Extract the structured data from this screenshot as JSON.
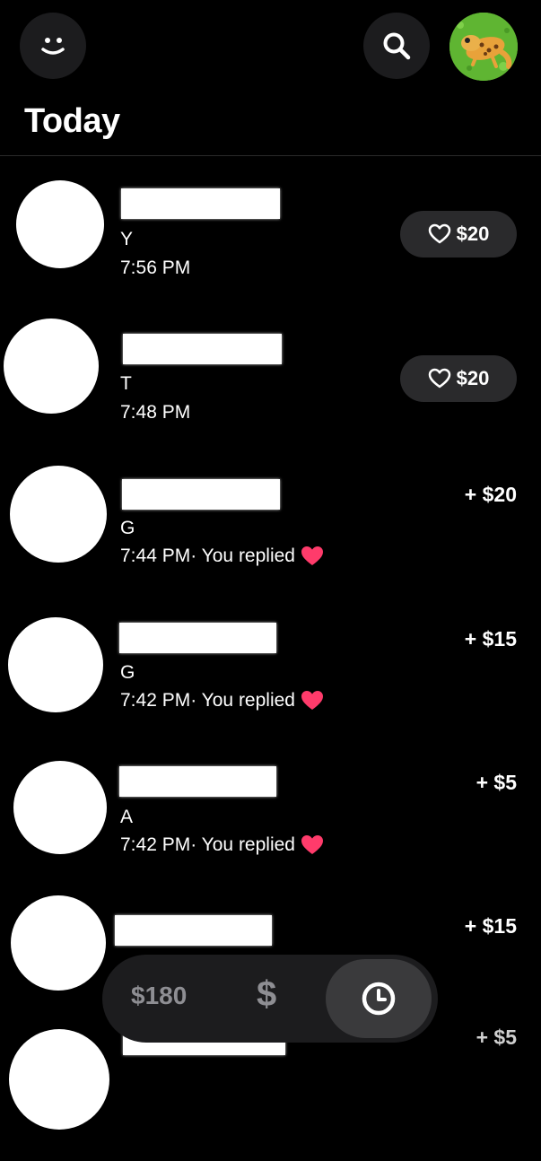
{
  "header": {
    "title": "Today",
    "profile_icon": "smiley-face-icon",
    "search_icon": "search-icon",
    "avatar": "gecko-avatar"
  },
  "colors": {
    "background": "#000000",
    "surface": "#1c1c1e",
    "pill": "#2a2a2c",
    "muted": "#8e8e93",
    "heart": "#ff3b6b"
  },
  "activity": [
    {
      "initial": "Y",
      "time": "7:56 PM",
      "replied": "",
      "action": "like",
      "amount": "$20"
    },
    {
      "initial": "T",
      "time": "7:48 PM",
      "replied": "",
      "action": "like",
      "amount": "$20"
    },
    {
      "initial": "G",
      "time": "7:44 PM",
      "replied": " · You replied",
      "action": "received",
      "amount": "+ $20"
    },
    {
      "initial": "G",
      "time": "7:42 PM",
      "replied": " · You replied",
      "action": "received",
      "amount": "+ $15"
    },
    {
      "initial": "A",
      "time": "7:42 PM",
      "replied": " · You replied",
      "action": "received",
      "amount": "+ $5"
    },
    {
      "initial": "",
      "time": "",
      "replied": "",
      "action": "received",
      "amount": "+ $15"
    },
    {
      "initial": "",
      "time": "",
      "replied": "",
      "action": "received",
      "amount": "+ $5"
    }
  ],
  "bottom_nav": {
    "balance": "$180",
    "pay_symbol": "$",
    "activity_icon": "clock-icon"
  }
}
